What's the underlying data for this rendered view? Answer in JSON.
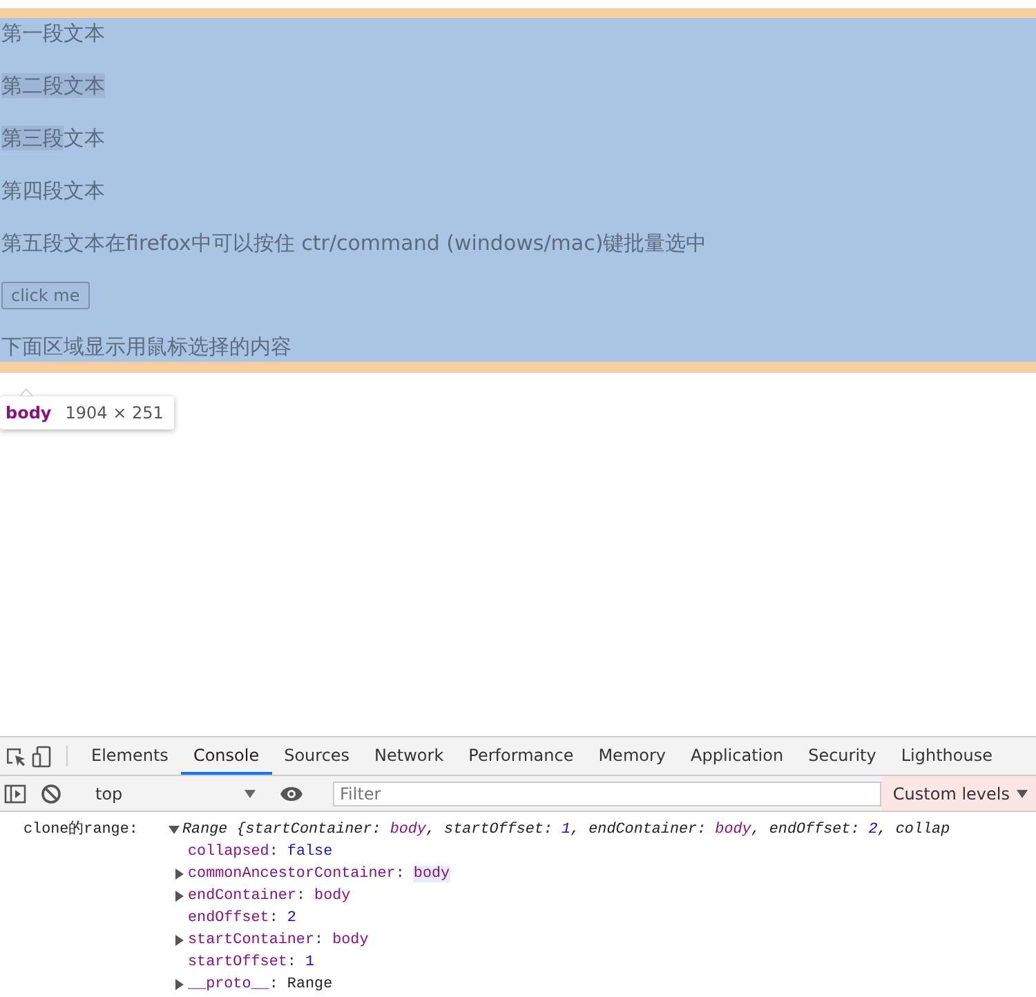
{
  "page": {
    "paragraphs": [
      {
        "segments": [
          {
            "text": "第一段文本",
            "selected": false
          }
        ]
      },
      {
        "segments": [
          {
            "text": "第二段文本 ",
            "selected": true
          }
        ]
      },
      {
        "segments": [
          {
            "text": "第三段",
            "selected": true
          },
          {
            "text": "文本",
            "selected": false
          }
        ]
      },
      {
        "segments": [
          {
            "text": "第四段文本",
            "selected": false
          }
        ]
      },
      {
        "segments": [
          {
            "text": "第五段文本在firefox中可以按住 ctr/command (windows/mac)键批量选中",
            "selected": false
          }
        ]
      }
    ],
    "button": "click me",
    "footer_text": "下面区域显示用鼠标选择的内容",
    "inspect_tooltip": {
      "tag": "body",
      "size": "1904 × 251"
    }
  },
  "devtools": {
    "tabs": [
      {
        "label": "Elements",
        "selected": false
      },
      {
        "label": "Console",
        "selected": true
      },
      {
        "label": "Sources",
        "selected": false
      },
      {
        "label": "Network",
        "selected": false
      },
      {
        "label": "Performance",
        "selected": false
      },
      {
        "label": "Memory",
        "selected": false
      },
      {
        "label": "Application",
        "selected": false
      },
      {
        "label": "Security",
        "selected": false
      },
      {
        "label": "Lighthouse",
        "selected": false
      }
    ],
    "context": "top",
    "filter": {
      "placeholder": "Filter"
    },
    "levels": "Custom levels",
    "console": {
      "label": "clone的range:",
      "expanded": true,
      "separator": ":",
      "summary": [
        {
          "text": "Range {",
          "kind": "plain"
        },
        {
          "text": "startContainer: ",
          "kind": "plain"
        },
        {
          "text": "body",
          "kind": "node"
        },
        {
          "text": ", startOffset: ",
          "kind": "plain"
        },
        {
          "text": "1",
          "kind": "number"
        },
        {
          "text": ", endContainer: ",
          "kind": "plain"
        },
        {
          "text": "body",
          "kind": "node"
        },
        {
          "text": ", endOffset: ",
          "kind": "plain"
        },
        {
          "text": "2",
          "kind": "number"
        },
        {
          "text": ", collap",
          "kind": "plain"
        }
      ],
      "properties": [
        {
          "key": "collapsed",
          "value": "false",
          "kind": "keyword",
          "expandable": false,
          "hovered": false
        },
        {
          "key": "commonAncestorContainer",
          "value": "body",
          "kind": "node",
          "expandable": true,
          "hovered": true
        },
        {
          "key": "endContainer",
          "value": "body",
          "kind": "node",
          "expandable": true,
          "hovered": false
        },
        {
          "key": "endOffset",
          "value": "2",
          "kind": "number",
          "expandable": false,
          "hovered": false
        },
        {
          "key": "startContainer",
          "value": "body",
          "kind": "node",
          "expandable": true,
          "hovered": false
        },
        {
          "key": "startOffset",
          "value": "1",
          "kind": "number",
          "expandable": false,
          "hovered": false
        },
        {
          "key": "__proto__",
          "value": "Range",
          "kind": "plain",
          "expandable": true,
          "hovered": false
        }
      ]
    }
  }
}
